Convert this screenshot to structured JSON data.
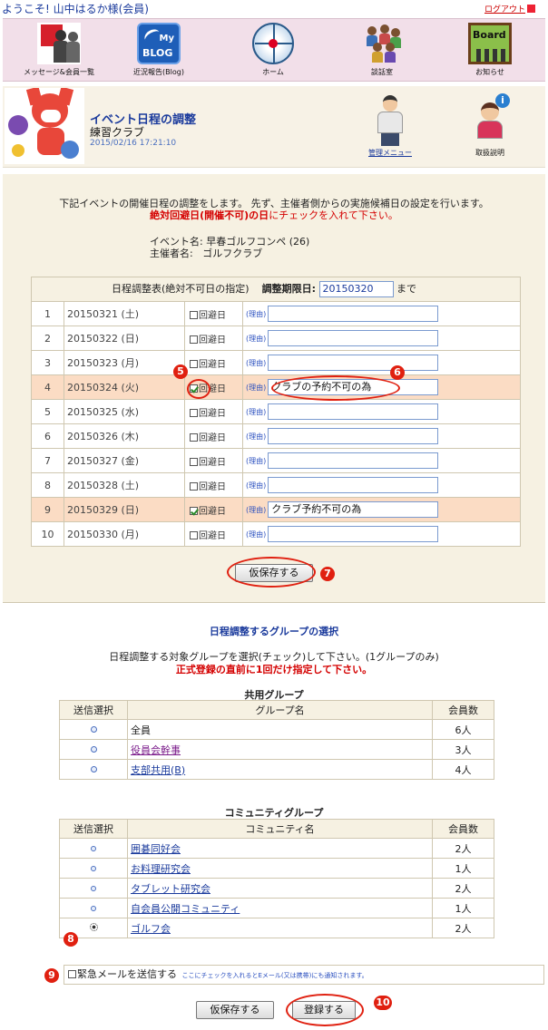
{
  "topbar": {
    "welcome": "ようこそ! 山中はるか様(会員)",
    "logout": "ログアウト"
  },
  "nav": [
    {
      "label": "メッセージ&会員一覧",
      "icon": "message-members-icon"
    },
    {
      "label": "近況報告(Blog)",
      "icon": "blog-icon",
      "icon_text_top": "My",
      "icon_text_bottom": "BLOG"
    },
    {
      "label": "ホーム",
      "icon": "compass-home-icon"
    },
    {
      "label": "談話室",
      "icon": "discussion-room-icon"
    },
    {
      "label": "お知らせ",
      "icon": "board-icon",
      "icon_text": "Board"
    }
  ],
  "header": {
    "title": "イベント日程の調整",
    "club": "練習クラブ",
    "datetime": "2015/02/16 17:21:10",
    "admin_menu": "管理メニュー",
    "manual": "取扱説明"
  },
  "intro": {
    "line1": "下記イベントの開催日程の調整をします。 先ず、主催者側からの実施候補日の設定を行います。",
    "line2_bold": "絶対回避日(開催不可)の日",
    "line2_rest": "にチェックを入れて下さい。"
  },
  "event": {
    "name_label": "イベント名:",
    "name": "早春ゴルフコンペ (26)",
    "host_label": "主催者名:",
    "host": "ゴルフクラブ"
  },
  "schedule": {
    "table_title": "日程調整表(絶対不可日の指定)",
    "deadline_label": "調整期限日:",
    "deadline_value": "20150320",
    "deadline_suffix": "まで",
    "avoid_label": "回避日",
    "reason_label": "(理由)",
    "rows": [
      {
        "no": "1",
        "date": "20150321 (土)",
        "checked": false,
        "reason": ""
      },
      {
        "no": "2",
        "date": "20150322 (日)",
        "checked": false,
        "reason": ""
      },
      {
        "no": "3",
        "date": "20150323 (月)",
        "checked": false,
        "reason": ""
      },
      {
        "no": "4",
        "date": "20150324 (火)",
        "checked": true,
        "reason": "クラブの予約不可の為"
      },
      {
        "no": "5",
        "date": "20150325 (水)",
        "checked": false,
        "reason": ""
      },
      {
        "no": "6",
        "date": "20150326 (木)",
        "checked": false,
        "reason": ""
      },
      {
        "no": "7",
        "date": "20150327 (金)",
        "checked": false,
        "reason": ""
      },
      {
        "no": "8",
        "date": "20150328 (土)",
        "checked": false,
        "reason": ""
      },
      {
        "no": "9",
        "date": "20150329 (日)",
        "checked": true,
        "reason": "クラブ予約不可の為"
      },
      {
        "no": "10",
        "date": "20150330 (月)",
        "checked": false,
        "reason": ""
      }
    ],
    "temp_save": "仮保存する"
  },
  "markers": {
    "m5": "5",
    "m6": "6",
    "m7": "7",
    "m8": "8",
    "m9": "9",
    "m10": "10"
  },
  "groups": {
    "title": "日程調整するグループの選択",
    "desc1": "日程調整する対象グループを選択(チェック)して下さい。(1グループのみ)",
    "desc2": "正式登録の直前に1回だけ指定して下さい。",
    "shared_title": "共用グループ",
    "shared_headers": [
      "送信選択",
      "グループ名",
      "会員数"
    ],
    "shared": [
      {
        "name": "全員",
        "count": "6人",
        "link": false
      },
      {
        "name": "役員会幹事",
        "count": "3人",
        "link": true
      },
      {
        "name": "支部共用(B)",
        "count": "4人",
        "link": true
      }
    ],
    "community_title": "コミュニティグループ",
    "community_headers": [
      "送信選択",
      "コミュニティ名",
      "会員数"
    ],
    "community": [
      {
        "name": "囲碁同好会",
        "count": "2人",
        "selected": false
      },
      {
        "name": "お料理研究会",
        "count": "1人",
        "selected": false
      },
      {
        "name": "タブレット研究会",
        "count": "2人",
        "selected": false
      },
      {
        "name": "自会員公開コミュニティ",
        "count": "1人",
        "selected": false
      },
      {
        "name": "ゴルフ会",
        "count": "2人",
        "selected": true
      }
    ]
  },
  "urgent": {
    "label": "緊急メールを送信する",
    "note": "ここにチェックを入れるとEメール(又は携帯)にも通知されます。"
  },
  "footer": {
    "temp_save": "仮保存する",
    "register": "登録する"
  }
}
